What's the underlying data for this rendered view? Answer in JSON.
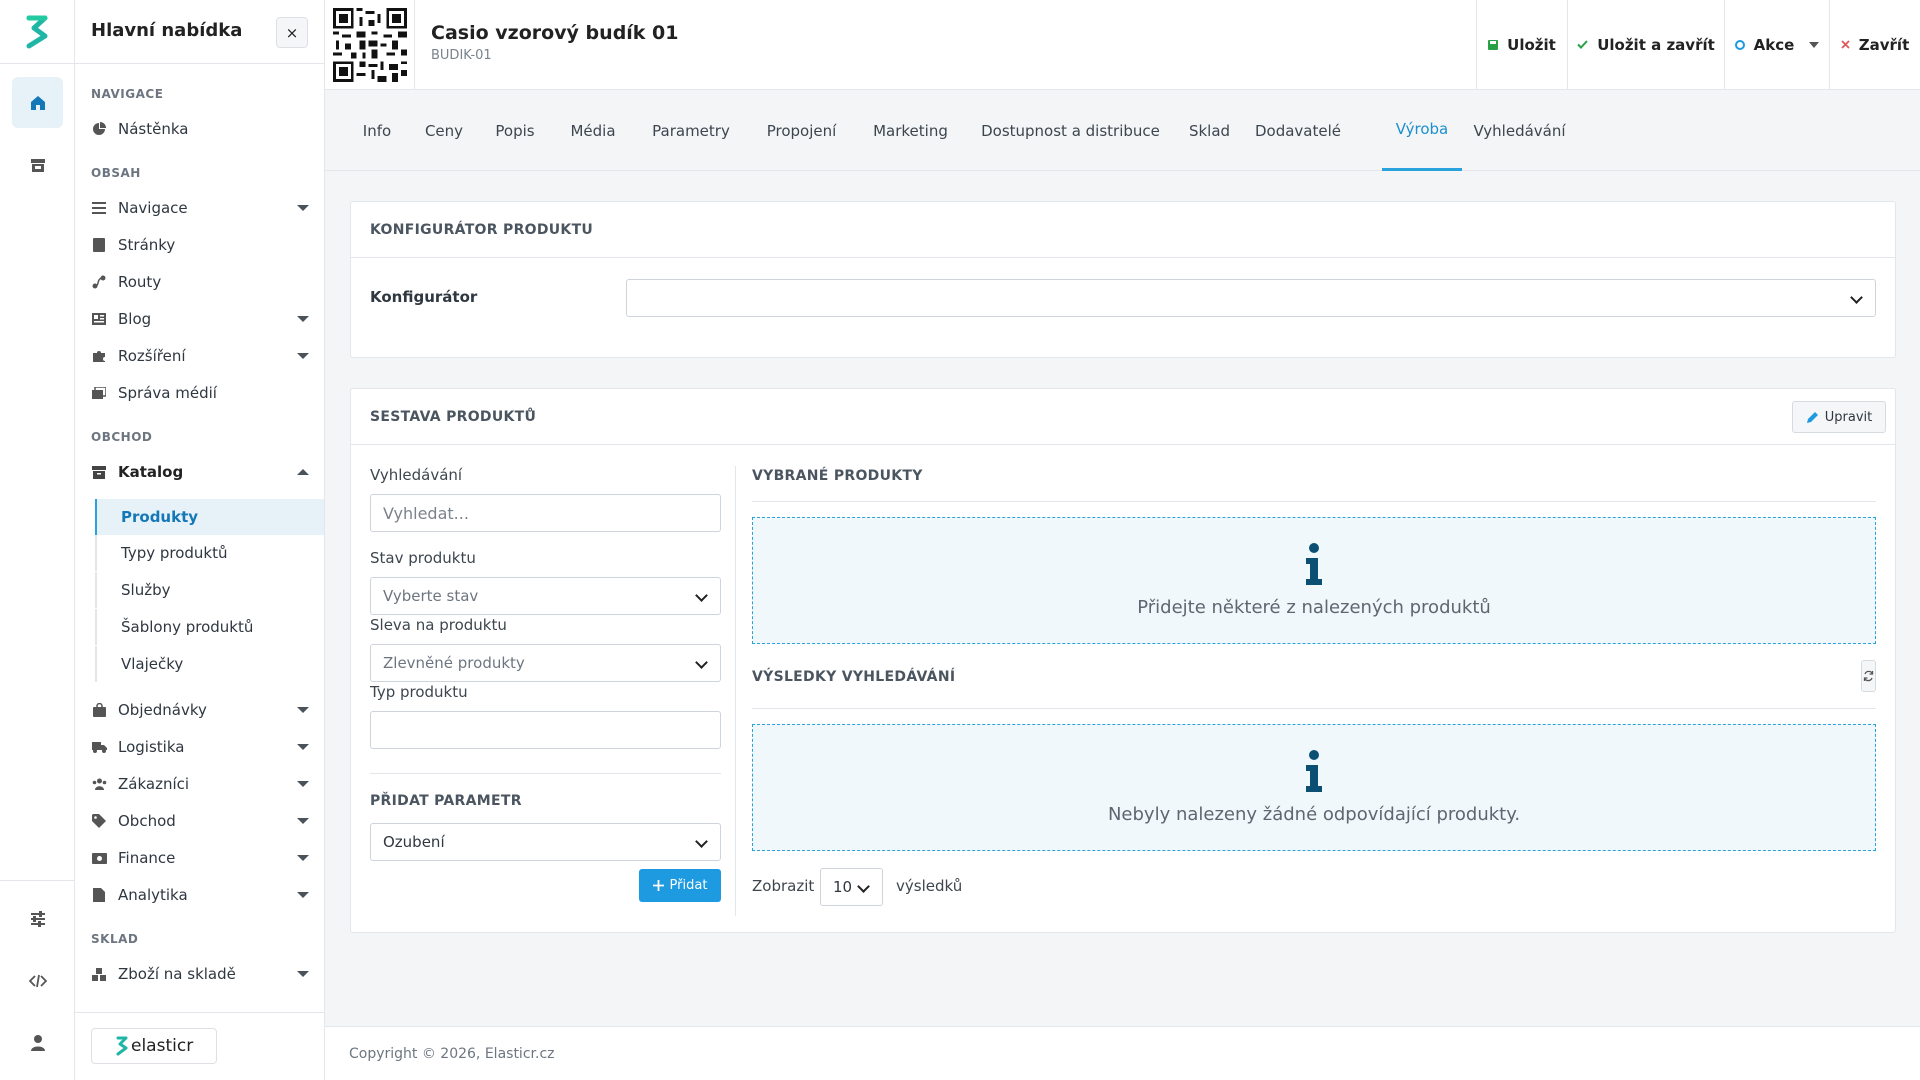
{
  "sidebar": {
    "title": "Hlavní nabídka",
    "close_label": "×",
    "sections": {
      "navigace": "NAVIGACE",
      "obsah": "OBSAH",
      "obchod": "OBCHOD",
      "sklad": "SKLAD"
    },
    "items": {
      "nastenka": "Nástěnka",
      "navigace": "Navigace",
      "stranky": "Stránky",
      "routy": "Routy",
      "blog": "Blog",
      "rozsireni": "Rozšíření",
      "sprava_medii": "Správa médií",
      "katalog": "Katalog",
      "objednavky": "Objednávky",
      "logistika": "Logistika",
      "zakaznici": "Zákazníci",
      "obchod": "Obchod",
      "finance": "Finance",
      "analytika": "Analytika",
      "zbozi_na_sklade": "Zboží na skladě"
    },
    "catalog_sub": {
      "produkty": "Produkty",
      "typy_produktu": "Typy produktů",
      "sluzby": "Služby",
      "sablony_produktu": "Šablony produktů",
      "vlajecky": "Vlaječky"
    },
    "brand": "elasticr"
  },
  "header": {
    "product_title": "Casio vzorový budík 01",
    "product_code": "BUDIK-01",
    "actions": {
      "save": "Uložit",
      "save_close": "Uložit a zavřít",
      "actions": "Akce",
      "close": "Zavřít"
    }
  },
  "tabs": {
    "info": "Info",
    "ceny": "Ceny",
    "popis": "Popis",
    "media": "Média",
    "parametry": "Parametry",
    "propojeni": "Propojení",
    "marketing": "Marketing",
    "dostupnost": "Dostupnost a distribuce",
    "sklad": "Sklad",
    "dodavatele": "Dodavatelé",
    "vyroba": "Výroba",
    "vyhledavani": "Vyhledávání"
  },
  "configurator": {
    "heading": "KONFIGURÁTOR PRODUKTU",
    "label": "Konfigurátor",
    "value": ""
  },
  "assembly": {
    "heading": "SESTAVA PRODUKTŮ",
    "edit_label": "Upravit",
    "search_label": "Vyhledávání",
    "search_placeholder": "Vyhledat...",
    "status_label": "Stav produktu",
    "status_value": "Vyberte stav",
    "discount_label": "Sleva na produktu",
    "discount_value": "Zlevněné produkty",
    "type_label": "Typ produktu",
    "type_value": "",
    "add_param_heading": "PŘIDAT PARAMETR",
    "param_value": "Ozubení",
    "add_label": "Přidat",
    "selected_heading": "VYBRANÉ PRODUKTY",
    "selected_empty": "Přidejte některé z nalezených produktů",
    "results_heading": "VÝSLEDKY VYHLEDÁVÁNÍ",
    "results_empty": "Nebyly nalezeny žádné odpovídající produkty.",
    "show_label": "Zobrazit",
    "page_size": "10",
    "results_suffix": "výsledků"
  },
  "colors": {
    "accent": "#2aa3dd",
    "save_icon": "#27a046",
    "close_icon": "#e05a5a",
    "brand": "#1fb6a6"
  },
  "footer": {
    "copyright": "Copyright © 2026, Elasticr.cz"
  }
}
